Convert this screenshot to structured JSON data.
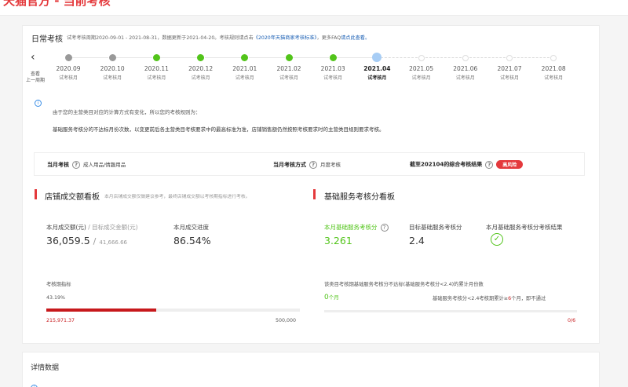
{
  "top": {
    "title": "天猫官方 - 当前考核"
  },
  "header": {
    "title": "日常考核",
    "note_pre": "试考考核周期2020-09-01 - 2021-08-31，数据更新于2021-04-20。考核规则请点击",
    "note_link": "《2020年天猫商家考核标准》",
    "note_mid": "，更多FAQ",
    "note_link2": "请点此查看。"
  },
  "nav": {
    "back_label_1": "查看",
    "back_label_2": "上一周期"
  },
  "timeline": {
    "months": [
      {
        "date": "2020.09",
        "label": "试考核月",
        "status": "gray"
      },
      {
        "date": "2020.10",
        "label": "试考核月",
        "status": "gray"
      },
      {
        "date": "2020.11",
        "label": "试考核月",
        "status": "green"
      },
      {
        "date": "2020.12",
        "label": "试考核月",
        "status": "green"
      },
      {
        "date": "2021.01",
        "label": "试考核月",
        "status": "green"
      },
      {
        "date": "2021.02",
        "label": "试考核月",
        "status": "green"
      },
      {
        "date": "2021.03",
        "label": "试考核月",
        "status": "green"
      },
      {
        "date": "2021.04",
        "label": "试考核月",
        "status": "current"
      },
      {
        "date": "2021.05",
        "label": "试考核月",
        "status": "future"
      },
      {
        "date": "2021.06",
        "label": "试考核月",
        "status": "future"
      },
      {
        "date": "2021.07",
        "label": "试考核月",
        "status": "future"
      },
      {
        "date": "2021.08",
        "label": "试考核月",
        "status": "future"
      }
    ]
  },
  "notice": {
    "icon": "i",
    "line1": "由于您的主营类目对应的计算方式有变化，所以您的考核规则为：",
    "line2": "基础服务考核分的不达标月份次数，以变更前后各主营类目考核要求中的最高标准为准，店铺销售额仍然按照考核要求时的主营类目规则要求考核。"
  },
  "summary": {
    "month_label": "当月考核",
    "month_value": "成人用品/情趣用品",
    "method_label": "当月考核方式",
    "method_value": "月度考核",
    "result_label": "截至202104的综合考核结果",
    "result_value": "高风险",
    "q": "?"
  },
  "store": {
    "title": "店铺成交额看板",
    "subtitle": "本月店铺成交额仅做建议参考，最终店铺成交额以考核期指标进行考核。",
    "amount_label": "本月成交额(元)",
    "target_label": "/ 目标成交金额(元)",
    "amount": "36,059.5",
    "sep": "/",
    "target": "41,666.66",
    "progress_label": "本月成交进度",
    "progress": "86.54%",
    "period_label": "考核期指标",
    "period_pct": "43.19%",
    "period_fraction": 0.4319,
    "period_value": "215,971.37",
    "period_target": "500,000"
  },
  "service": {
    "title": "基础服务考核分看板",
    "score_label": "本月基础服务考核分",
    "score": "3.261",
    "target_label": "目标基础服务考核分",
    "target": "2.4",
    "result_label": "本月基础服务考核分考核结果",
    "result_icon": "✓",
    "count_title": "该类目考核期基础服务考核分不达标(基础服务考核分<2.4)的累计月份数",
    "count_value": "0",
    "count_unit": "个月",
    "rule_pre": "基础服务考核分<2.4考核期累计≥",
    "rule_num": "6",
    "rule_post": "个月，即不通过",
    "progress_text": "0/6"
  },
  "details": {
    "title": "详情数据"
  },
  "colors": {
    "accent": "#e4393c",
    "green": "#52c41a",
    "link": "#1a5fb4"
  }
}
